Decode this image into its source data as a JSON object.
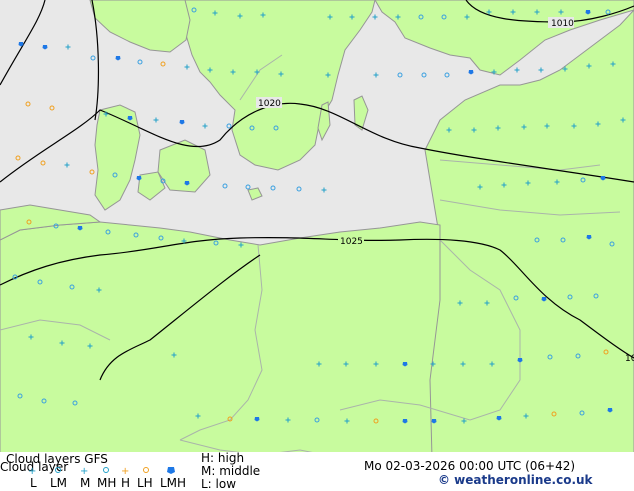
{
  "map": {
    "isobars": [
      {
        "label": "1010"
      },
      {
        "label": "1020"
      },
      {
        "label": "1025"
      }
    ],
    "clipped_isobar_label": "10",
    "colors": {
      "land": "#c8fb9e",
      "sea": "#e8e8e8",
      "coast": "#969696",
      "border": "#aab4aa",
      "isobar": "#000000",
      "symbol_high": "#3aa0e0",
      "symbol_middle": "#22a0c8",
      "symbol_low": "#f0a020",
      "symbol_dense": "#1e78e6"
    }
  },
  "legend": {
    "title": "Cloud layers  GFS",
    "row1_label": "Cloud layer",
    "row2_labels": [
      "L",
      "LM",
      "M",
      "MH",
      "H",
      "LH",
      "LMH"
    ],
    "key_high": "H: high",
    "key_middle": "M: middle",
    "key_low": "L: low",
    "timestamp": "Mo 02-03-2026 00:00 UTC (06+42)",
    "credit": "© weatheronline.co.uk"
  }
}
